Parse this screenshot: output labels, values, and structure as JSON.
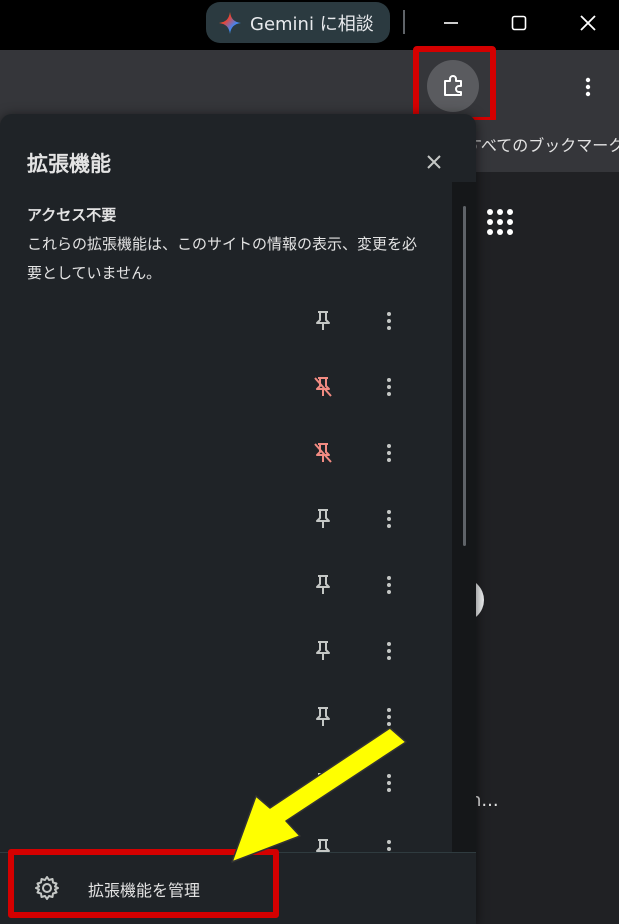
{
  "titlebar": {
    "gemini_label": "Gemini に相談",
    "window_controls": [
      "minimize-icon",
      "maximize-icon",
      "close-icon"
    ]
  },
  "toolbar": {
    "extensions_icon": "puzzle-icon",
    "menu_icon": "kebab-icon"
  },
  "bookmarks": {
    "all_bookmarks_label": "すべてのブックマーク"
  },
  "page": {
    "ellipsis": "n..."
  },
  "panel": {
    "title": "拡張機能",
    "close_icon": "close-icon",
    "section_heading": "アクセス不要",
    "section_description": "これらの拡張機能は、このサイトの情報の表示、変更を必要としていません。",
    "extensions": [
      {
        "pin_state": "pinned"
      },
      {
        "pin_state": "unpinned"
      },
      {
        "pin_state": "unpinned"
      },
      {
        "pin_state": "pinned"
      },
      {
        "pin_state": "pinned"
      },
      {
        "pin_state": "pinned"
      },
      {
        "pin_state": "pinned"
      },
      {
        "pin_state": "pinned"
      },
      {
        "pin_state": "pinned"
      }
    ],
    "manage_label": "拡張機能を管理",
    "manage_icon": "gear-icon"
  },
  "colors": {
    "pin_off": "#f28b82",
    "pin_on": "#c4c7c5",
    "annotation_red": "#d40000",
    "annotation_yellow": "#ffff00"
  }
}
